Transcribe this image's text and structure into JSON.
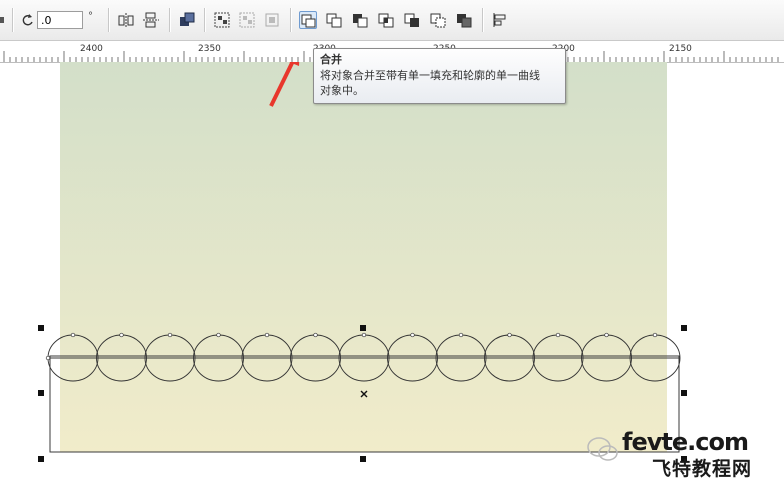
{
  "toolbar": {
    "rotation_value": ".0",
    "degree_symbol": "°",
    "buttons": [
      {
        "name": "mirror-horizontal",
        "icon": "mirror-horizontal-icon"
      },
      {
        "name": "mirror-vertical",
        "icon": "mirror-vertical-icon"
      },
      {
        "name": "arrange-order",
        "icon": "order-icon"
      },
      {
        "name": "group",
        "icon": "group-icon"
      },
      {
        "name": "ungroup",
        "icon": "ungroup-icon"
      },
      {
        "name": "ungroup-all",
        "icon": "ungroup-all-icon"
      },
      {
        "name": "combine",
        "icon": "combine-icon",
        "active": true
      },
      {
        "name": "weld",
        "icon": "weld-icon"
      },
      {
        "name": "trim",
        "icon": "trim-icon"
      },
      {
        "name": "intersect",
        "icon": "intersect-icon"
      },
      {
        "name": "simplify",
        "icon": "simplify-icon"
      },
      {
        "name": "front-minus-back",
        "icon": "front-minus-back-icon"
      },
      {
        "name": "back-minus-front",
        "icon": "back-minus-front-icon"
      },
      {
        "name": "align-distribute",
        "icon": "align-icon"
      }
    ]
  },
  "ruler": {
    "labels": [
      "2400",
      "2350",
      "2300",
      "2250",
      "2200",
      "2150"
    ]
  },
  "tooltip": {
    "title": "合并",
    "description_line1": "将对象合并至带有单一填充和轮廓的单一曲线",
    "description_line2": "对象中。"
  },
  "canvas": {
    "circle_count": 13,
    "gradient_top": "#d3dfc9",
    "gradient_bottom": "#f1ecca",
    "arrow_color": "#e8372c"
  },
  "watermark": {
    "latin": "fevte.com",
    "chinese": "飞特教程网"
  }
}
